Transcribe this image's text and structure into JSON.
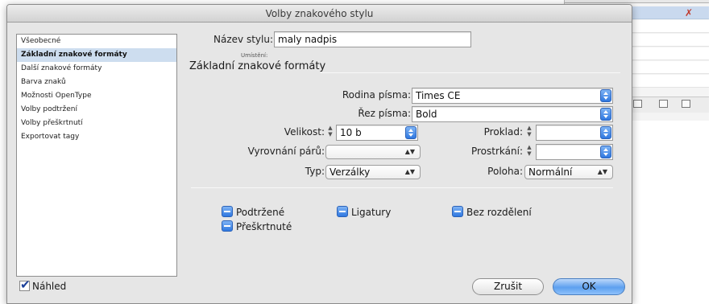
{
  "dialog": {
    "title": "Volby znakového stylu"
  },
  "sidebar": {
    "items": [
      {
        "label": "Všeobecné"
      },
      {
        "label": "Základní znakové formáty"
      },
      {
        "label": "Další znakové formáty"
      },
      {
        "label": "Barva znaků"
      },
      {
        "label": "Možnosti OpenType"
      },
      {
        "label": "Volby podtržení"
      },
      {
        "label": "Volby přeškrtnutí"
      },
      {
        "label": "Exportovat tagy"
      }
    ],
    "selected_index": 1
  },
  "style_name": {
    "label": "Název stylu:",
    "value": "maly nadpis",
    "location_label": "Umístění:"
  },
  "section": {
    "title": "Základní znakové formáty"
  },
  "fields": {
    "font_family": {
      "label": "Rodina písma:",
      "value": "Times CE"
    },
    "font_style": {
      "label": "Řez písma:",
      "value": "Bold"
    },
    "size": {
      "label": "Velikost:",
      "value": "10 b"
    },
    "leading": {
      "label": "Proklad:",
      "value": ""
    },
    "kerning": {
      "label": "Vyrovnání párů:",
      "value": ""
    },
    "tracking": {
      "label": "Prostrkání:",
      "value": ""
    },
    "case": {
      "label": "Typ:",
      "value": "Verzálky"
    },
    "position": {
      "label": "Poloha:",
      "value": "Normální"
    }
  },
  "checkboxes": {
    "underline": "Podtržené",
    "ligatures": "Ligatury",
    "no_break": "Bez rozdělení",
    "strikethrough": "Přeškrtnuté"
  },
  "footer": {
    "preview": "Náhled",
    "preview_checked": true,
    "cancel": "Zrušit",
    "ok": "OK"
  },
  "colors": {
    "accent": "#2f78e0",
    "selection": "#cdddef"
  }
}
